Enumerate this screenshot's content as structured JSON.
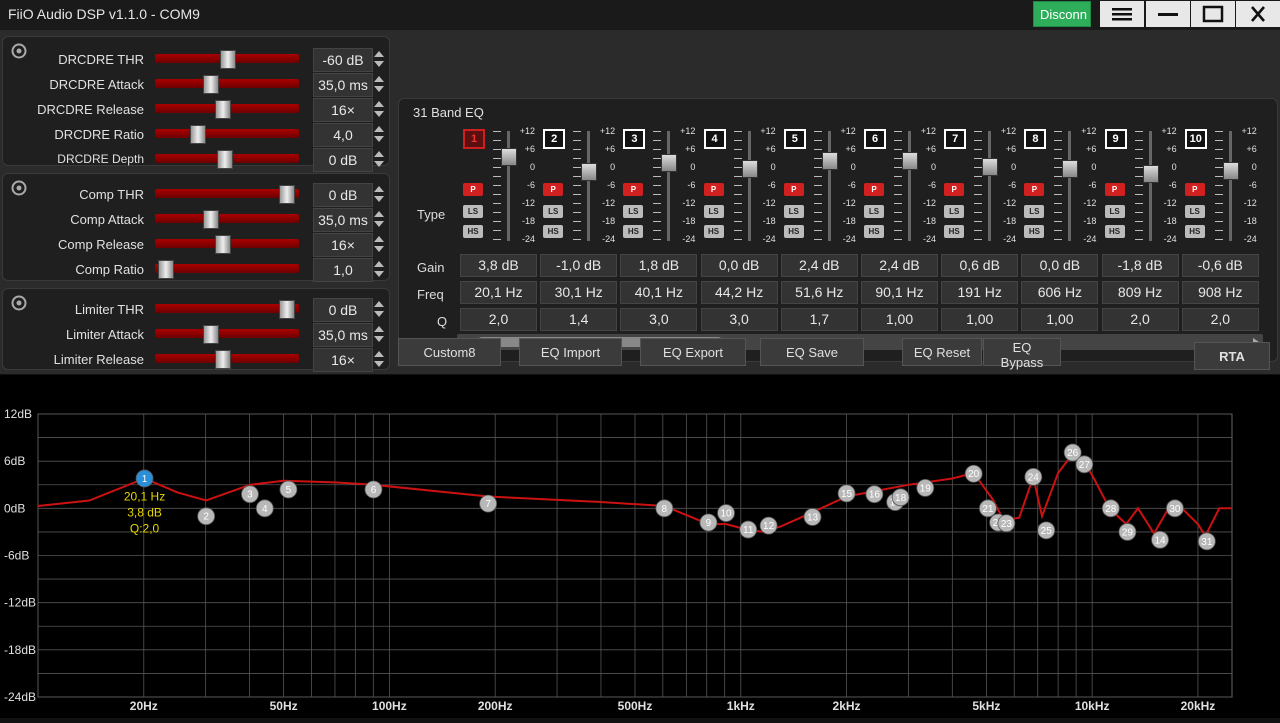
{
  "window": {
    "title": "FiiO Audio DSP v1.1.0 - COM9",
    "disconnect_label": "Disconn"
  },
  "groups": [
    {
      "rows": [
        {
          "label": "DRCDRE THR",
          "value": "-60 dB",
          "level": 0.5
        },
        {
          "label": "DRCDRE Attack",
          "value": "35,0 ms",
          "level": 0.37
        },
        {
          "label": "DRCDRE Release",
          "value": "16×",
          "level": 0.46
        },
        {
          "label": "DRCDRE Ratio",
          "value": "4,0",
          "level": 0.27
        },
        {
          "label": "DRCDRE Depth",
          "value": "0 dB",
          "level": 0.48
        }
      ]
    },
    {
      "rows": [
        {
          "label": "Comp THR",
          "value": "0 dB",
          "level": 0.95
        },
        {
          "label": "Comp Attack",
          "value": "35,0 ms",
          "level": 0.37
        },
        {
          "label": "Comp Release",
          "value": "16×",
          "level": 0.46
        },
        {
          "label": "Comp Ratio",
          "value": "1,0",
          "level": 0.02
        }
      ]
    },
    {
      "rows": [
        {
          "label": "Limiter THR",
          "value": "0 dB",
          "level": 0.95
        },
        {
          "label": "Limiter Attack",
          "value": "35,0 ms",
          "level": 0.37
        },
        {
          "label": "Limiter Release",
          "value": "16×",
          "level": 0.46
        }
      ]
    }
  ],
  "eq": {
    "title": "31 Band EQ",
    "row_labels": {
      "type": "Type",
      "gain": "Gain",
      "freq": "Freq",
      "q": "Q"
    },
    "scale": [
      "+12",
      "+6",
      "0",
      "-6",
      "-12",
      "-18",
      "-24"
    ],
    "type_labels": [
      "P",
      "LS",
      "HS"
    ],
    "bands": [
      {
        "num": "1",
        "gain": "3,8 dB",
        "freq": "20,1 Hz",
        "q": "2,0",
        "gain_db": 3.8,
        "selected": true
      },
      {
        "num": "2",
        "gain": "-1,0 dB",
        "freq": "30,1 Hz",
        "q": "1,4",
        "gain_db": -1.0
      },
      {
        "num": "3",
        "gain": "1,8 dB",
        "freq": "40,1 Hz",
        "q": "3,0",
        "gain_db": 1.8
      },
      {
        "num": "4",
        "gain": "0,0 dB",
        "freq": "44,2 Hz",
        "q": "3,0",
        "gain_db": 0.0
      },
      {
        "num": "5",
        "gain": "2,4 dB",
        "freq": "51,6 Hz",
        "q": "1,7",
        "gain_db": 2.4
      },
      {
        "num": "6",
        "gain": "2,4 dB",
        "freq": "90,1 Hz",
        "q": "1,00",
        "gain_db": 2.4
      },
      {
        "num": "7",
        "gain": "0,6 dB",
        "freq": "191 Hz",
        "q": "1,00",
        "gain_db": 0.6
      },
      {
        "num": "8",
        "gain": "0,0 dB",
        "freq": "606 Hz",
        "q": "1,00",
        "gain_db": 0.0
      },
      {
        "num": "9",
        "gain": "-1,8 dB",
        "freq": "809 Hz",
        "q": "2,0",
        "gain_db": -1.8
      },
      {
        "num": "10",
        "gain": "-0,6 dB",
        "freq": "908 Hz",
        "q": "2,0",
        "gain_db": -0.6
      }
    ],
    "buttons": {
      "preset": "Custom8",
      "import": "EQ Import",
      "export": "EQ Export",
      "save": "EQ Save",
      "reset": "EQ Reset",
      "bypass": "EQ Bypass",
      "rta": "RTA"
    }
  },
  "chart_data": {
    "type": "line",
    "y_ticks": [
      "12dB",
      "6dB",
      "0dB",
      "-6dB",
      "-12dB",
      "-18dB",
      "-24dB"
    ],
    "ylim": [
      -24,
      12
    ],
    "xlim": [
      10,
      25000
    ],
    "x_scale": "log",
    "x_ticks": [
      {
        "label": "20Hz",
        "hz": 20
      },
      {
        "label": "50Hz",
        "hz": 50
      },
      {
        "label": "100Hz",
        "hz": 100
      },
      {
        "label": "200Hz",
        "hz": 200
      },
      {
        "label": "500Hz",
        "hz": 500
      },
      {
        "label": "1kHz",
        "hz": 1000
      },
      {
        "label": "2kHz",
        "hz": 2000
      },
      {
        "label": "5kHz",
        "hz": 5000
      },
      {
        "label": "10kHz",
        "hz": 10000
      },
      {
        "label": "20kHz",
        "hz": 20000
      }
    ],
    "curve": [
      [
        10,
        0.3
      ],
      [
        14,
        1.0
      ],
      [
        20.1,
        3.8
      ],
      [
        25,
        2.0
      ],
      [
        30.1,
        1.0
      ],
      [
        40.1,
        3.0
      ],
      [
        50,
        3.5
      ],
      [
        70,
        3.3
      ],
      [
        90.1,
        3.0
      ],
      [
        191,
        1.5
      ],
      [
        400,
        0.8
      ],
      [
        606,
        0.3
      ],
      [
        809,
        -2.0
      ],
      [
        908,
        -2.0
      ],
      [
        1000,
        -2.5
      ],
      [
        1150,
        -3.0
      ],
      [
        1300,
        -2.3
      ],
      [
        1600,
        -0.5
      ],
      [
        2000,
        1.5
      ],
      [
        3000,
        3.0
      ],
      [
        4000,
        3.8
      ],
      [
        4600,
        4.5
      ],
      [
        5200,
        1.2
      ],
      [
        5600,
        -1.5
      ],
      [
        6200,
        -1.2
      ],
      [
        6800,
        4.0
      ],
      [
        7200,
        -1.0
      ],
      [
        8000,
        4.5
      ],
      [
        9000,
        7.5
      ],
      [
        10000,
        4.2
      ],
      [
        11200,
        0.0
      ],
      [
        12500,
        -2.0
      ],
      [
        13500,
        0.0
      ],
      [
        15000,
        -3.2
      ],
      [
        16500,
        0.0
      ],
      [
        18000,
        0.0
      ],
      [
        20000,
        -2.0
      ],
      [
        21000,
        -3.5
      ],
      [
        23000,
        0.0
      ],
      [
        25000,
        0.0
      ]
    ],
    "markers": [
      {
        "id": "1",
        "hz": 20.1,
        "db": 3.8,
        "selected": true
      },
      {
        "id": "2",
        "hz": 30.1,
        "db": -1.0
      },
      {
        "id": "3",
        "hz": 40.1,
        "db": 1.8
      },
      {
        "id": "4",
        "hz": 44.2,
        "db": 0.0
      },
      {
        "id": "5",
        "hz": 51.6,
        "db": 2.4
      },
      {
        "id": "6",
        "hz": 90.1,
        "db": 2.4
      },
      {
        "id": "7",
        "hz": 191,
        "db": 0.6
      },
      {
        "id": "8",
        "hz": 606,
        "db": 0.0
      },
      {
        "id": "9",
        "hz": 809,
        "db": -1.8
      },
      {
        "id": "10",
        "hz": 908,
        "db": -0.6
      },
      {
        "id": "11",
        "hz": 1050,
        "db": -2.7
      },
      {
        "id": "12",
        "hz": 1200,
        "db": -2.2
      },
      {
        "id": "13",
        "hz": 1600,
        "db": -1.1
      },
      {
        "id": "15",
        "hz": 2000,
        "db": 1.9
      },
      {
        "id": "16",
        "hz": 2400,
        "db": 1.8
      },
      {
        "id": "17",
        "hz": 2750,
        "db": 0.8
      },
      {
        "id": "18",
        "hz": 2850,
        "db": 1.4
      },
      {
        "id": "19",
        "hz": 3350,
        "db": 2.6
      },
      {
        "id": "20",
        "hz": 4600,
        "db": 4.4
      },
      {
        "id": "21",
        "hz": 5050,
        "db": 0.0
      },
      {
        "id": "22",
        "hz": 5400,
        "db": -1.8
      },
      {
        "id": "23",
        "hz": 5700,
        "db": -1.9
      },
      {
        "id": "24",
        "hz": 6800,
        "db": 4.0
      },
      {
        "id": "25",
        "hz": 7400,
        "db": -2.8
      },
      {
        "id": "26",
        "hz": 8800,
        "db": 7.1
      },
      {
        "id": "27",
        "hz": 9500,
        "db": 5.6
      },
      {
        "id": "28",
        "hz": 11300,
        "db": 0.0
      },
      {
        "id": "29",
        "hz": 12600,
        "db": -3.0
      },
      {
        "id": "30",
        "hz": 17200,
        "db": 0.0
      },
      {
        "id": "14",
        "hz": 15600,
        "db": -4.0
      },
      {
        "id": "31",
        "hz": 21200,
        "db": -4.2
      }
    ],
    "tooltip": {
      "freq": "20,1 Hz",
      "gain": "3,8 dB",
      "q": "Q:2,0"
    },
    "colors": {
      "curve": "#cc1111",
      "marker": "#b8b8b8",
      "selected": "#2a8fd8",
      "tooltip": "#e6d600"
    }
  }
}
